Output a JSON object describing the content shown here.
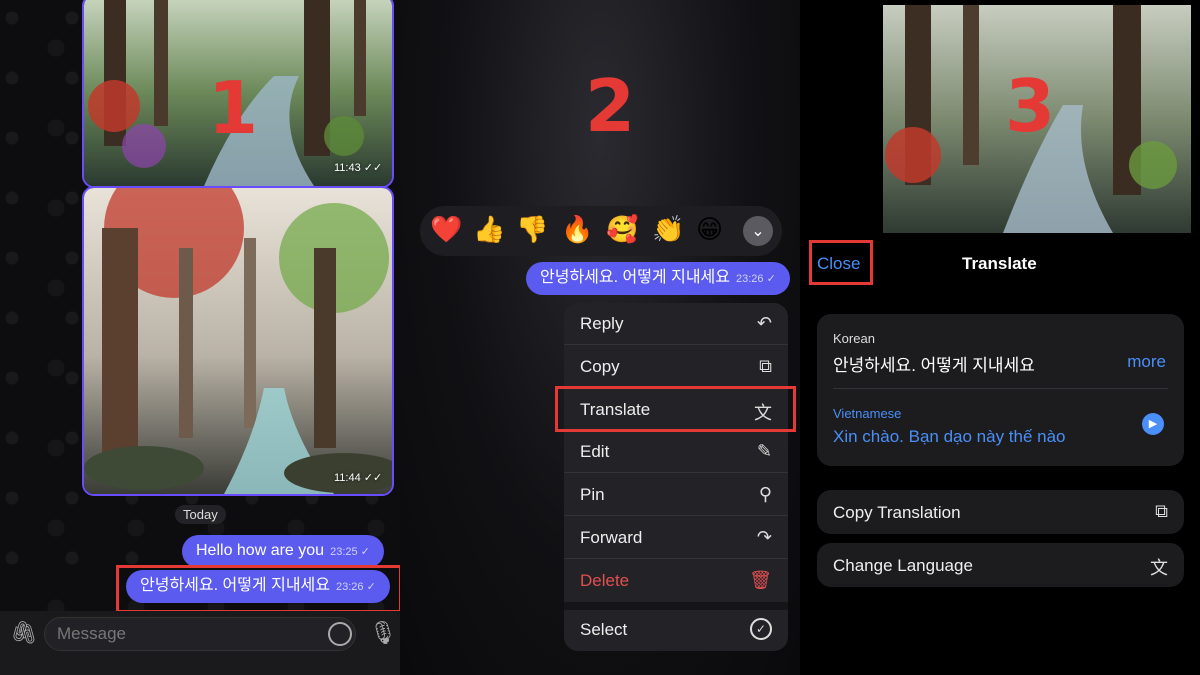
{
  "steps": {
    "one": "1",
    "two": "2",
    "three": "3"
  },
  "panel1": {
    "photo1_time": "11:43",
    "photo2_time": "11:44",
    "date_chip": "Today",
    "messages": [
      {
        "text": "Hello how are you",
        "time": "23:25"
      },
      {
        "text": "안녕하세요. 어떻게 지내세요",
        "time": "23:26"
      }
    ],
    "input_placeholder": "Message",
    "icons": {
      "attach": "paperclip-icon",
      "sticker": "sticker-icon",
      "mic": "microphone-icon"
    }
  },
  "panel2": {
    "reactions": [
      "❤️",
      "👍",
      "👎",
      "🔥",
      "🥰",
      "👏",
      "😁"
    ],
    "expand_icon": "chevron-down-icon",
    "message": {
      "text": "안녕하세요. 어떻게 지내세요",
      "time": "23:26"
    },
    "menu": [
      {
        "label": "Reply",
        "icon": "↶"
      },
      {
        "label": "Copy",
        "icon": "⧉"
      },
      {
        "label": "Translate",
        "icon": "文"
      },
      {
        "label": "Edit",
        "icon": "✎"
      },
      {
        "label": "Pin",
        "icon": "⚲"
      },
      {
        "label": "Forward",
        "icon": "↷"
      },
      {
        "label": "Delete",
        "icon": "🗑"
      },
      {
        "label": "Select",
        "icon": "✓"
      }
    ]
  },
  "panel3": {
    "close_label": "Close",
    "title": "Translate",
    "source_lang": "Korean",
    "source_text": "안녕하세요. 어떻게 지내세요",
    "more_label": "more",
    "target_lang": "Vietnamese",
    "target_text": "Xin chào. Bạn dạo này thế nào",
    "copy_label": "Copy Translation",
    "change_label": "Change Language"
  },
  "colors": {
    "accent": "#4a8ef7",
    "bubble": "#5b5bf0",
    "highlight": "#e53935",
    "delete": "#e05050"
  }
}
